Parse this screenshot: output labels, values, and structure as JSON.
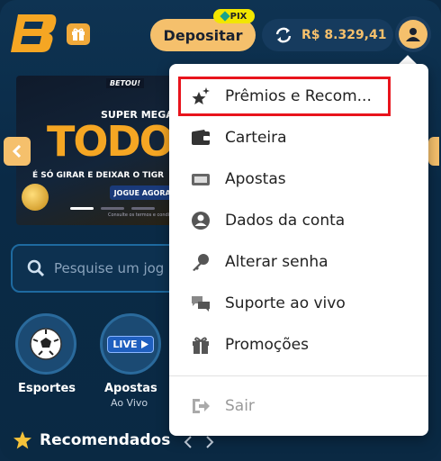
{
  "header": {
    "deposit_label": "Depositar",
    "pix_label": "PIX",
    "balance": "R$ 8.329,41"
  },
  "banner": {
    "brand": "BETOU!",
    "line1": "SUPER MEGA",
    "headline": "TODO",
    "subline": "É SÓ GIRAR E DEIXAR O TIGR",
    "cta": "JOGUE AGORA!",
    "terms": "Consulte os termos e condiç"
  },
  "search": {
    "placeholder": "Pesquise um jog"
  },
  "categories": [
    {
      "label": "Esportes",
      "sub": ""
    },
    {
      "label": "Apostas",
      "sub": "Ao Vivo",
      "badge": "LIVE"
    }
  ],
  "section": {
    "title": "Recomendados"
  },
  "menu": {
    "items": [
      {
        "label": "Prêmios e Recom...",
        "icon": "sparkle-star-icon"
      },
      {
        "label": "Carteira",
        "icon": "wallet-icon"
      },
      {
        "label": "Apostas",
        "icon": "ticket-icon"
      },
      {
        "label": "Dados da conta",
        "icon": "user-circle-icon"
      },
      {
        "label": "Alterar senha",
        "icon": "key-icon"
      },
      {
        "label": "Suporte ao vivo",
        "icon": "chat-bubbles-icon"
      },
      {
        "label": "Promoções",
        "icon": "gift-icon"
      }
    ],
    "logout_label": "Sair"
  },
  "colors": {
    "accent": "#f5c06c",
    "background": "#0b2a45",
    "highlight": "#e8141c",
    "pix": "#f2e600"
  }
}
